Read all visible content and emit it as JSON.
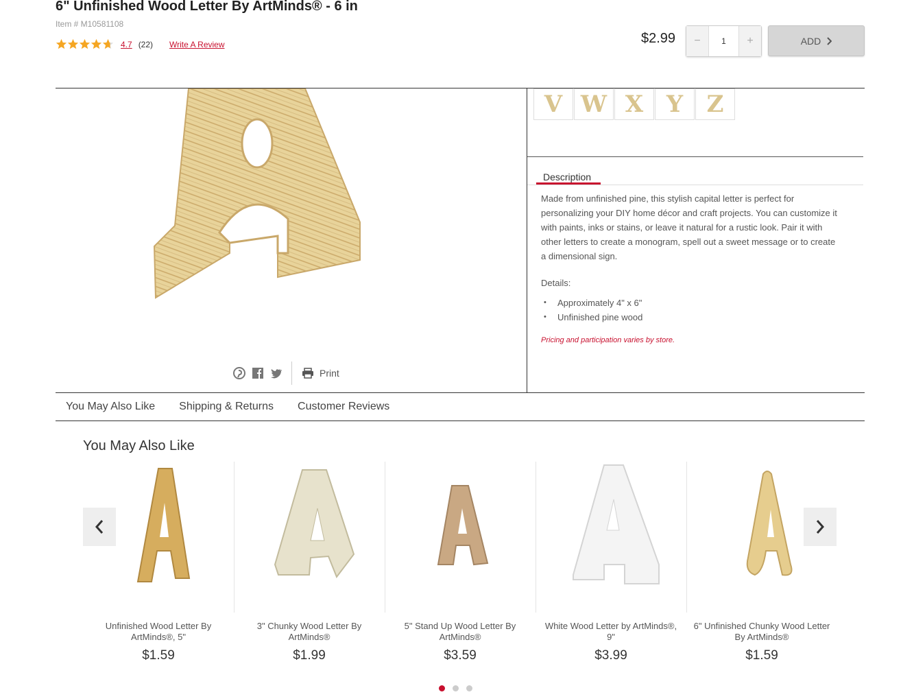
{
  "product": {
    "title": "6\" Unfinished Wood Letter By ArtMinds®  - 6 in",
    "item_number": "Item # M10581108",
    "rating_value": "4.7",
    "rating_count": "(22)",
    "write_review": "Write A Review",
    "price": "$2.99",
    "quantity": "1",
    "qty_minus": "−",
    "qty_plus": "+",
    "add_label": "ADD"
  },
  "thumbnails": [
    "V",
    "W",
    "X",
    "Y",
    "Z"
  ],
  "description": {
    "tab_label": "Description",
    "body": "Made from unfinished pine, this stylish capital letter is perfect for personalizing your DIY home décor and craft projects. You can customize it with paints, inks or stains, or leave it natural for a rustic look. Pair it with other letters to create a monogram, spell out a sweet message or to create a dimensional sign.",
    "details_label": "Details:",
    "details": [
      "Approximately 4\" x 6\"",
      "Unfinished pine wood"
    ],
    "disclaimer": "Pricing and participation varies by store."
  },
  "share": {
    "print_label": "Print"
  },
  "tabs": [
    "You May Also Like",
    "Shipping & Returns",
    "Customer Reviews"
  ],
  "recommendations": {
    "title": "You May Also Like",
    "items": [
      {
        "name": "Unfinished Wood Letter By ArtMinds®, 5\"",
        "price": "$1.59"
      },
      {
        "name": "3\" Chunky Wood Letter By ArtMinds®",
        "price": "$1.99"
      },
      {
        "name": "5\" Stand Up Wood Letter By ArtMinds®",
        "price": "$3.59"
      },
      {
        "name": "White Wood Letter by ArtMinds®, 9\"",
        "price": "$3.99"
      },
      {
        "name": "6\" Unfinished Chunky Wood Letter By ArtMinds®",
        "price": "$1.59"
      }
    ]
  },
  "colors": {
    "accent": "#c8102e",
    "star": "#f5a623"
  }
}
